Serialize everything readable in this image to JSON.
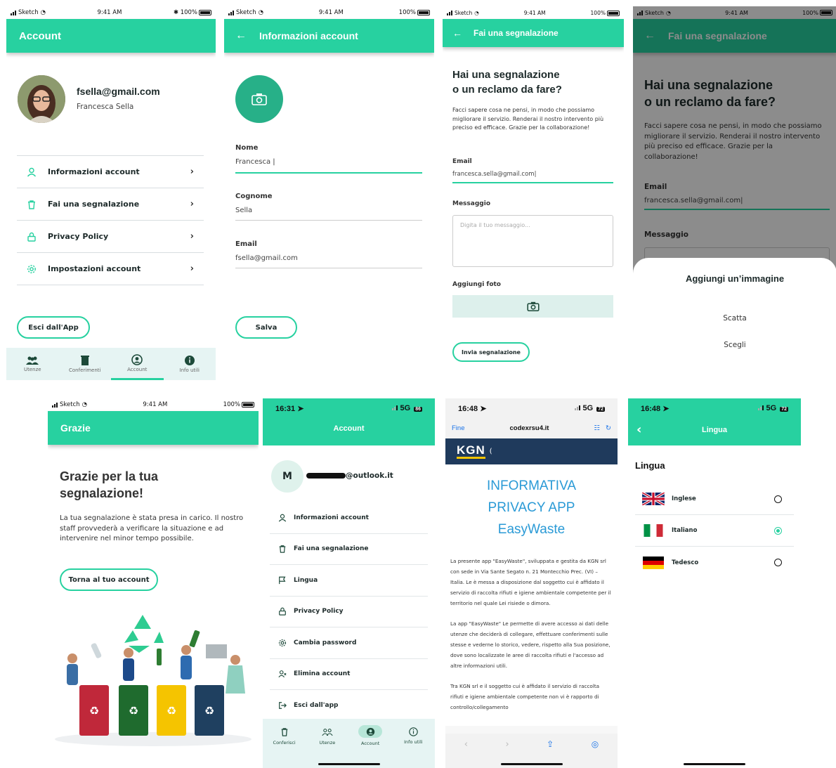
{
  "colors": {
    "accent": "#27d1a0",
    "dark_overlay": "rgba(0,0,0,0.45)",
    "bin_red": "#c0283a",
    "bin_green": "#1f6b2e",
    "bin_yellow": "#f5c400",
    "bin_blue": "#1f4060"
  },
  "status": {
    "carrier": "Sketch",
    "time": "9:41 AM",
    "battery": "100%"
  },
  "s1": {
    "title": "Account",
    "email": "fsella@gmail.com",
    "name": "Francesca Sella",
    "menu": [
      {
        "label": "Informazioni account",
        "icon": "user-icon"
      },
      {
        "label": "Fai una segnalazione",
        "icon": "trash-icon"
      },
      {
        "label": "Privacy Policy",
        "icon": "lock-icon"
      },
      {
        "label": "Impostazioni account",
        "icon": "gear-icon"
      }
    ],
    "logout": "Esci dall'App",
    "nav": [
      "Utenze",
      "Conferimenti",
      "Account",
      "Info utili"
    ]
  },
  "s2": {
    "title": "Informazioni account",
    "nome_label": "Nome",
    "nome_value": "Francesca",
    "cognome_label": "Cognome",
    "cognome_value": "Sella",
    "email_label": "Email",
    "email_value": "fsella@gmail.com",
    "save": "Salva"
  },
  "s3": {
    "title": "Fai una segnalazione",
    "heading1": "Hai una segnalazione",
    "heading2": "o un reclamo da fare?",
    "desc": "Facci sapere cosa ne pensi, in modo che possiamo migliorare il servizio. Renderai il nostro intervento più preciso ed efficace. Grazie per la collaborazione!",
    "email_label": "Email",
    "email_value": "francesca.sella@gmail.com",
    "msg_label": "Messaggio",
    "msg_placeholder": "Digita il tuo messaggio...",
    "photo_label": "Aggiungi foto",
    "submit": "Invia segnalazione"
  },
  "s4": {
    "title": "Fai una segnalazione",
    "heading1": "Hai una segnalazione",
    "heading2": "o un reclamo da fare?",
    "desc": "Facci sapere cosa ne pensi, in modo che possiamo migliorare il servizio. Renderai il nostro intervento più preciso ed efficace. Grazie per la collaborazione!",
    "email_label": "Email",
    "email_value": "francesca.sella@gmail.com",
    "msg_label": "Messaggio",
    "sheet_title": "Aggiungi un’immagine",
    "opt1": "Scatta",
    "opt2": "Scegli"
  },
  "s5": {
    "title": "Grazie",
    "heading1": "Grazie per la tua",
    "heading2": "segnalazione!",
    "desc": "La tua segnalazione è stata presa in carico. Il nostro staff provvederà a verificare la situazione e ad intervenire nel minor tempo possibile.",
    "back": "Torna al tuo account"
  },
  "s6": {
    "time": "16:31",
    "net": "5G",
    "batt": "86",
    "title": "Account",
    "avatar": "M",
    "email": "@outlook.it",
    "menu": [
      {
        "label": "Informazioni account",
        "icon": "user-icon"
      },
      {
        "label": "Fai una segnalazione",
        "icon": "trash-icon"
      },
      {
        "label": "Lingua",
        "icon": "flag-icon"
      },
      {
        "label": "Privacy Policy",
        "icon": "lock-icon"
      },
      {
        "label": "Cambia password",
        "icon": "gear-icon"
      },
      {
        "label": "Elimina account",
        "icon": "user-remove-icon"
      },
      {
        "label": "Esci dall'app",
        "icon": "logout-icon"
      }
    ],
    "nav": [
      "Conferisci",
      "Utenze",
      "Account",
      "Info utili"
    ]
  },
  "s7": {
    "time": "16:48",
    "net": "5G",
    "batt": "72",
    "done": "Fine",
    "url": "codexrsu4.it",
    "logo": "KGN",
    "title1": "INFORMATIVA",
    "title2": "PRIVACY APP",
    "title3": "EasyWaste",
    "p1": "La presente app \"EasyWaste\", sviluppata e gestita da KGN srl con sede in Via Sante Segato n. 21 Montecchio Prec. (VI) – Italia. Le è messa a disposizione dal soggetto cui è affidato il servizio di raccolta rifiuti e igiene ambientale competente per il territorio nel quale Lei risiede o dimora.",
    "p2": "La app \"EasyWaste\" Le permette di avere accesso ai dati delle utenze che deciderà di collegare, effettuare conferimenti sulle stesse e vederne lo storico, vedere, rispetto alla Sua posizione, dove sono localizzate le aree di raccolta rifiuti e l'accesso ad altre informazioni utili.",
    "p3": "Tra KGN srl e il soggetto cui è affidato il servizio di raccolta rifiuti e igiene ambientale competente non vi è rapporto di controllo/collegamento"
  },
  "s8": {
    "time": "16:48",
    "net": "5G",
    "batt": "72",
    "title": "Lingua",
    "heading": "Lingua",
    "langs": [
      {
        "label": "Inglese",
        "selected": false
      },
      {
        "label": "Italiano",
        "selected": true
      },
      {
        "label": "Tedesco",
        "selected": false
      }
    ]
  }
}
